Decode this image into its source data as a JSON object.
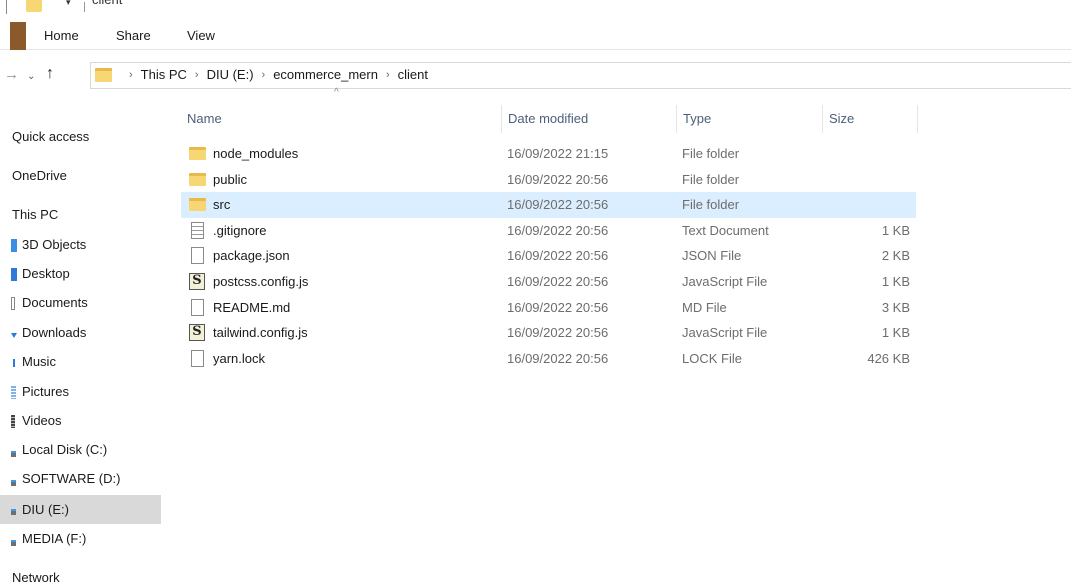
{
  "window": {
    "title": "client"
  },
  "ribbon": {
    "tabs": [
      "Home",
      "Share",
      "View"
    ]
  },
  "address": {
    "crumbs": [
      "This PC",
      "DIU (E:)",
      "ecommerce_mern",
      "client"
    ],
    "separator": "›"
  },
  "nav": {
    "forward_icon": "→",
    "history_icon": "⌄",
    "up_icon": "↑"
  },
  "sidebar": {
    "items": [
      {
        "label": "Quick access",
        "icon": "",
        "selected": false
      },
      {
        "label": "OneDrive",
        "icon": "",
        "selected": false
      },
      {
        "label": "This PC",
        "icon": "",
        "selected": false
      },
      {
        "label": "3D Objects",
        "icon": "3d-objects-icon",
        "selected": false
      },
      {
        "label": "Desktop",
        "icon": "desktop-icon",
        "selected": false
      },
      {
        "label": "Documents",
        "icon": "documents-icon",
        "selected": false
      },
      {
        "label": "Downloads",
        "icon": "downloads-icon",
        "selected": false
      },
      {
        "label": "Music",
        "icon": "music-icon",
        "selected": false
      },
      {
        "label": "Pictures",
        "icon": "pictures-icon",
        "selected": false
      },
      {
        "label": "Videos",
        "icon": "videos-icon",
        "selected": false
      },
      {
        "label": "Local Disk (C:)",
        "icon": "drive-icon",
        "selected": false
      },
      {
        "label": "SOFTWARE (D:)",
        "icon": "drive-icon",
        "selected": false
      },
      {
        "label": "DIU (E:)",
        "icon": "drive-icon",
        "selected": true
      },
      {
        "label": "MEDIA (F:)",
        "icon": "drive-icon",
        "selected": false
      },
      {
        "label": "Network",
        "icon": "",
        "selected": false
      }
    ]
  },
  "columns": {
    "name": "Name",
    "date": "Date modified",
    "type": "Type",
    "size": "Size",
    "sort_indicator": "^"
  },
  "files": [
    {
      "name": "node_modules",
      "date": "16/09/2022 21:15",
      "type": "File folder",
      "size": "",
      "icon": "folder-icon",
      "selected": false
    },
    {
      "name": "public",
      "date": "16/09/2022 20:56",
      "type": "File folder",
      "size": "",
      "icon": "folder-icon",
      "selected": false
    },
    {
      "name": "src",
      "date": "16/09/2022 20:56",
      "type": "File folder",
      "size": "",
      "icon": "folder-icon",
      "selected": true
    },
    {
      "name": ".gitignore",
      "date": "16/09/2022 20:56",
      "type": "Text Document",
      "size": "1 KB",
      "icon": "text-file-icon",
      "selected": false
    },
    {
      "name": "package.json",
      "date": "16/09/2022 20:56",
      "type": "JSON File",
      "size": "2 KB",
      "icon": "file-icon",
      "selected": false
    },
    {
      "name": "postcss.config.js",
      "date": "16/09/2022 20:56",
      "type": "JavaScript File",
      "size": "1 KB",
      "icon": "js-file-icon",
      "selected": false
    },
    {
      "name": "README.md",
      "date": "16/09/2022 20:56",
      "type": "MD File",
      "size": "3 KB",
      "icon": "file-icon",
      "selected": false
    },
    {
      "name": "tailwind.config.js",
      "date": "16/09/2022 20:56",
      "type": "JavaScript File",
      "size": "1 KB",
      "icon": "js-file-icon",
      "selected": false
    },
    {
      "name": "yarn.lock",
      "date": "16/09/2022 20:56",
      "type": "LOCK File",
      "size": "426 KB",
      "icon": "file-icon",
      "selected": false
    }
  ],
  "colors": {
    "selected_row": "#dbeeff",
    "selected_nav": "#d9d9d9",
    "folder": "#f7d774",
    "header_text": "#4c607a"
  }
}
